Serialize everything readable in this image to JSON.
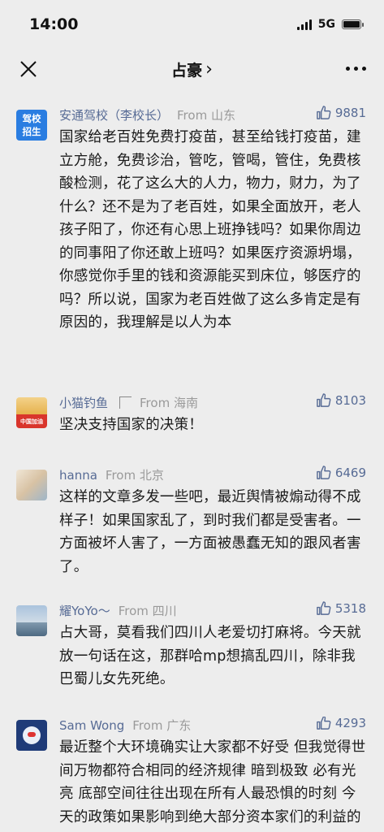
{
  "status": {
    "time": "14:00",
    "network": "5G"
  },
  "nav": {
    "title": "占豪",
    "chevron": "›"
  },
  "comments": [
    {
      "author": "安通驾校（李校长）",
      "from": "From 山东",
      "likes": "9881",
      "avatar_text_top": "驾校",
      "avatar_text_bottom": "招生",
      "text": "国家给老百姓免费打疫苗，甚至给钱打疫苗，建立方舱，免费诊治，管吃，管喝，管住，免费核酸检测，花了这么大的人力，物力，财力，为了什么？还不是为了老百姓，如果全面放开，老人孩子阳了，你还有心思上班挣钱吗？如果你周边的同事阳了你还敢上班吗？如果医疗资源坍塌，你感觉你手里的钱和资源能买到床位，够医疗的吗？所以说，国家为老百姓做了这么多肯定是有原因的，我理解是以人为本"
    },
    {
      "author": "小猫钓鱼",
      "from": "From 海南",
      "likes": "8103",
      "avatar_text": "中国加油",
      "text": "坚决支持国家的决策！"
    },
    {
      "author": "hanna",
      "from": "From 北京",
      "likes": "6469",
      "text": "这样的文章多发一些吧，最近舆情被煽动得不成样子！如果国家乱了，到时我们都是受害者。一方面被坏人害了，一方面被愚蠢无知的跟风者害了。"
    },
    {
      "author": "耀YoYo～",
      "from": "From 四川",
      "likes": "5318",
      "text": "占大哥，莫看我们四川人老爱切打麻将。今天就放一句话在这，那群哈mp想搞乱四川，除非我巴蜀儿女先死绝。"
    },
    {
      "author": "Sam Wong",
      "from": "From 广东",
      "likes": "4293",
      "text": "最近整个大环境确实让大家都不好受 但我觉得世间万物都符合相同的经济规律 暗到极致 必有光亮 底部空间往往出现在所有人最恐惧的时刻 今天的政策如果影响到绝大部分资本家们的利益的话 我相信资本永不放"
    }
  ]
}
